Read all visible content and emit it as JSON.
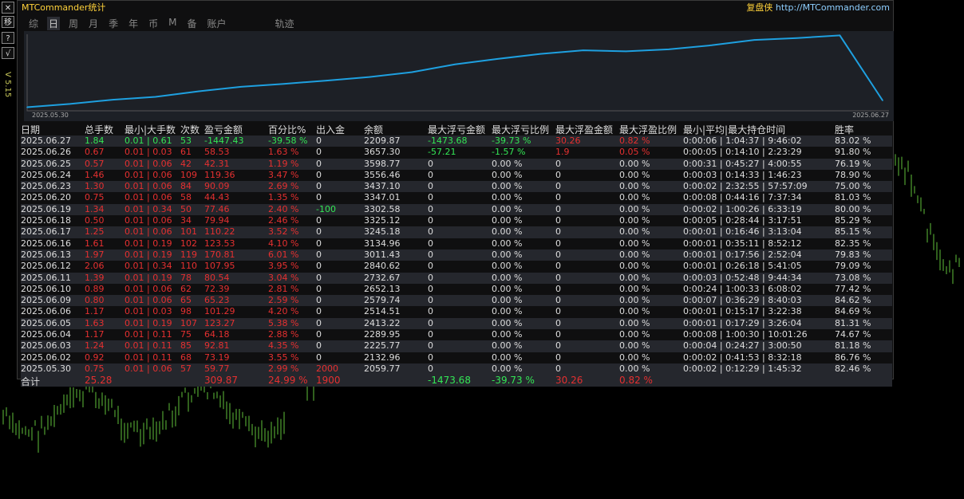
{
  "side_toolbar": {
    "buttons": [
      "✕",
      "移",
      "?",
      "√"
    ],
    "version": "V 5.15"
  },
  "panel": {
    "title": "MTCommander统计",
    "brand_cn": "复盘侠",
    "brand_url": "http://MTCommander.com",
    "tabs": [
      "综",
      "日",
      "周",
      "月",
      "季",
      "年",
      "币",
      "M",
      "备",
      "账户",
      "轨迹"
    ],
    "active_tab": "日"
  },
  "chart_data": {
    "type": "line",
    "x_start_label": "2025.05.30",
    "x_end_label": "2025.06.27",
    "x": [
      "2025.05.30",
      "2025.06.02",
      "2025.06.03",
      "2025.06.04",
      "2025.06.05",
      "2025.06.06",
      "2025.06.09",
      "2025.06.10",
      "2025.06.11",
      "2025.06.12",
      "2025.06.13",
      "2025.06.16",
      "2025.06.17",
      "2025.06.18",
      "2025.06.19",
      "2025.06.20",
      "2025.06.23",
      "2025.06.24",
      "2025.06.25",
      "2025.06.26",
      "2025.06.27"
    ],
    "values": [
      2059.77,
      2132.96,
      2225.77,
      2289.95,
      2413.22,
      2514.51,
      2579.74,
      2652.13,
      2732.67,
      2840.62,
      3011.43,
      3134.96,
      3245.18,
      3325.12,
      3302.58,
      3347.01,
      3437.1,
      3556.46,
      3598.77,
      3657.3,
      2209.87
    ],
    "color": "#1ea0e0"
  },
  "table": {
    "headers": [
      "日期",
      "总手数",
      "最小|大手数",
      "次数",
      "盈亏金额",
      "百分比%",
      "出入金",
      "余额",
      "最大浮亏金额",
      "最大浮亏比例",
      "最大浮盈金额",
      "最大浮盈比例",
      "最小|平均|最大持仓时间",
      "胜率"
    ],
    "rows": [
      [
        "2025.06.27",
        "1.84",
        "0.01 | 0.61",
        "53",
        "-1447.43",
        "-39.58 %",
        "0",
        "2209.87",
        "-1473.68",
        "-39.73 %",
        "30.26",
        "0.82 %",
        "0:00:06 | 1:04:37 | 9:46:02",
        "83.02 %"
      ],
      [
        "2025.06.26",
        "0.67",
        "0.01 | 0.03",
        "61",
        "58.53",
        "1.63 %",
        "0",
        "3657.30",
        "-57.21",
        "-1.57 %",
        "1.9",
        "0.05 %",
        "0:00:05 | 0:14:10 | 2:23:29",
        "91.80 %"
      ],
      [
        "2025.06.25",
        "0.57",
        "0.01 | 0.06",
        "42",
        "42.31",
        "1.19 %",
        "0",
        "3598.77",
        "0",
        "0.00 %",
        "0",
        "0.00 %",
        "0:00:31 | 0:45:27 | 4:00:55",
        "76.19 %"
      ],
      [
        "2025.06.24",
        "1.46",
        "0.01 | 0.06",
        "109",
        "119.36",
        "3.47 %",
        "0",
        "3556.46",
        "0",
        "0.00 %",
        "0",
        "0.00 %",
        "0:00:03 | 0:14:33 | 1:46:23",
        "78.90 %"
      ],
      [
        "2025.06.23",
        "1.30",
        "0.01 | 0.06",
        "84",
        "90.09",
        "2.69 %",
        "0",
        "3437.10",
        "0",
        "0.00 %",
        "0",
        "0.00 %",
        "0:00:02 | 2:32:55 | 57:57:09",
        "75.00 %"
      ],
      [
        "2025.06.20",
        "0.75",
        "0.01 | 0.06",
        "58",
        "44.43",
        "1.35 %",
        "0",
        "3347.01",
        "0",
        "0.00 %",
        "0",
        "0.00 %",
        "0:00:08 | 0:44:16 | 7:37:34",
        "81.03 %"
      ],
      [
        "2025.06.19",
        "1.34",
        "0.01 | 0.34",
        "50",
        "77.46",
        "2.40 %",
        "-100",
        "3302.58",
        "0",
        "0.00 %",
        "0",
        "0.00 %",
        "0:00:02 | 1:00:26 | 6:33:19",
        "80.00 %"
      ],
      [
        "2025.06.18",
        "0.50",
        "0.01 | 0.06",
        "34",
        "79.94",
        "2.46 %",
        "0",
        "3325.12",
        "0",
        "0.00 %",
        "0",
        "0.00 %",
        "0:00:05 | 0:28:44 | 3:17:51",
        "85.29 %"
      ],
      [
        "2025.06.17",
        "1.25",
        "0.01 | 0.06",
        "101",
        "110.22",
        "3.52 %",
        "0",
        "3245.18",
        "0",
        "0.00 %",
        "0",
        "0.00 %",
        "0:00:01 | 0:16:46 | 3:13:04",
        "85.15 %"
      ],
      [
        "2025.06.16",
        "1.61",
        "0.01 | 0.19",
        "102",
        "123.53",
        "4.10 %",
        "0",
        "3134.96",
        "0",
        "0.00 %",
        "0",
        "0.00 %",
        "0:00:01 | 0:35:11 | 8:52:12",
        "82.35 %"
      ],
      [
        "2025.06.13",
        "1.97",
        "0.01 | 0.19",
        "119",
        "170.81",
        "6.01 %",
        "0",
        "3011.43",
        "0",
        "0.00 %",
        "0",
        "0.00 %",
        "0:00:01 | 0:17:56 | 2:52:04",
        "79.83 %"
      ],
      [
        "2025.06.12",
        "2.06",
        "0.01 | 0.34",
        "110",
        "107.95",
        "3.95 %",
        "0",
        "2840.62",
        "0",
        "0.00 %",
        "0",
        "0.00 %",
        "0:00:01 | 0:26:18 | 5:41:05",
        "79.09 %"
      ],
      [
        "2025.06.11",
        "1.39",
        "0.01 | 0.19",
        "78",
        "80.54",
        "3.04 %",
        "0",
        "2732.67",
        "0",
        "0.00 %",
        "0",
        "0.00 %",
        "0:00:03 | 0:52:48 | 9:44:34",
        "73.08 %"
      ],
      [
        "2025.06.10",
        "0.89",
        "0.01 | 0.06",
        "62",
        "72.39",
        "2.81 %",
        "0",
        "2652.13",
        "0",
        "0.00 %",
        "0",
        "0.00 %",
        "0:00:24 | 1:00:33 | 6:08:02",
        "77.42 %"
      ],
      [
        "2025.06.09",
        "0.80",
        "0.01 | 0.06",
        "65",
        "65.23",
        "2.59 %",
        "0",
        "2579.74",
        "0",
        "0.00 %",
        "0",
        "0.00 %",
        "0:00:07 | 0:36:29 | 8:40:03",
        "84.62 %"
      ],
      [
        "2025.06.06",
        "1.17",
        "0.01 | 0.03",
        "98",
        "101.29",
        "4.20 %",
        "0",
        "2514.51",
        "0",
        "0.00 %",
        "0",
        "0.00 %",
        "0:00:01 | 0:15:17 | 3:22:38",
        "84.69 %"
      ],
      [
        "2025.06.05",
        "1.63",
        "0.01 | 0.19",
        "107",
        "123.27",
        "5.38 %",
        "0",
        "2413.22",
        "0",
        "0.00 %",
        "0",
        "0.00 %",
        "0:00:01 | 0:17:29 | 3:26:04",
        "81.31 %"
      ],
      [
        "2025.06.04",
        "1.17",
        "0.01 | 0.11",
        "75",
        "64.18",
        "2.88 %",
        "0",
        "2289.95",
        "0",
        "0.00 %",
        "0",
        "0.00 %",
        "0:00:08 | 1:00:30 | 10:01:26",
        "74.67 %"
      ],
      [
        "2025.06.03",
        "1.24",
        "0.01 | 0.11",
        "85",
        "92.81",
        "4.35 %",
        "0",
        "2225.77",
        "0",
        "0.00 %",
        "0",
        "0.00 %",
        "0:00:04 | 0:24:27 | 3:00:50",
        "81.18 %"
      ],
      [
        "2025.06.02",
        "0.92",
        "0.01 | 0.11",
        "68",
        "73.19",
        "3.55 %",
        "0",
        "2132.96",
        "0",
        "0.00 %",
        "0",
        "0.00 %",
        "0:00:02 | 0:41:53 | 8:32:18",
        "86.76 %"
      ],
      [
        "2025.05.30",
        "0.75",
        "0.01 | 0.06",
        "57",
        "59.77",
        "2.99 %",
        "2000",
        "2059.77",
        "0",
        "0.00 %",
        "0",
        "0.00 %",
        "0:00:02 | 0:12:29 | 1:45:32",
        "82.46 %"
      ]
    ],
    "total": [
      "合计",
      "25.28",
      "",
      "",
      "309.87",
      "24.99 %",
      "1900",
      "",
      "-1473.68",
      "-39.73 %",
      "30.26",
      "0.82 %",
      "",
      ""
    ]
  },
  "colors": {
    "positive": "#e53030",
    "negative": "#33e655",
    "title": "#ffd23a",
    "line": "#1ea0e0",
    "candle": "#5fbf3a"
  }
}
